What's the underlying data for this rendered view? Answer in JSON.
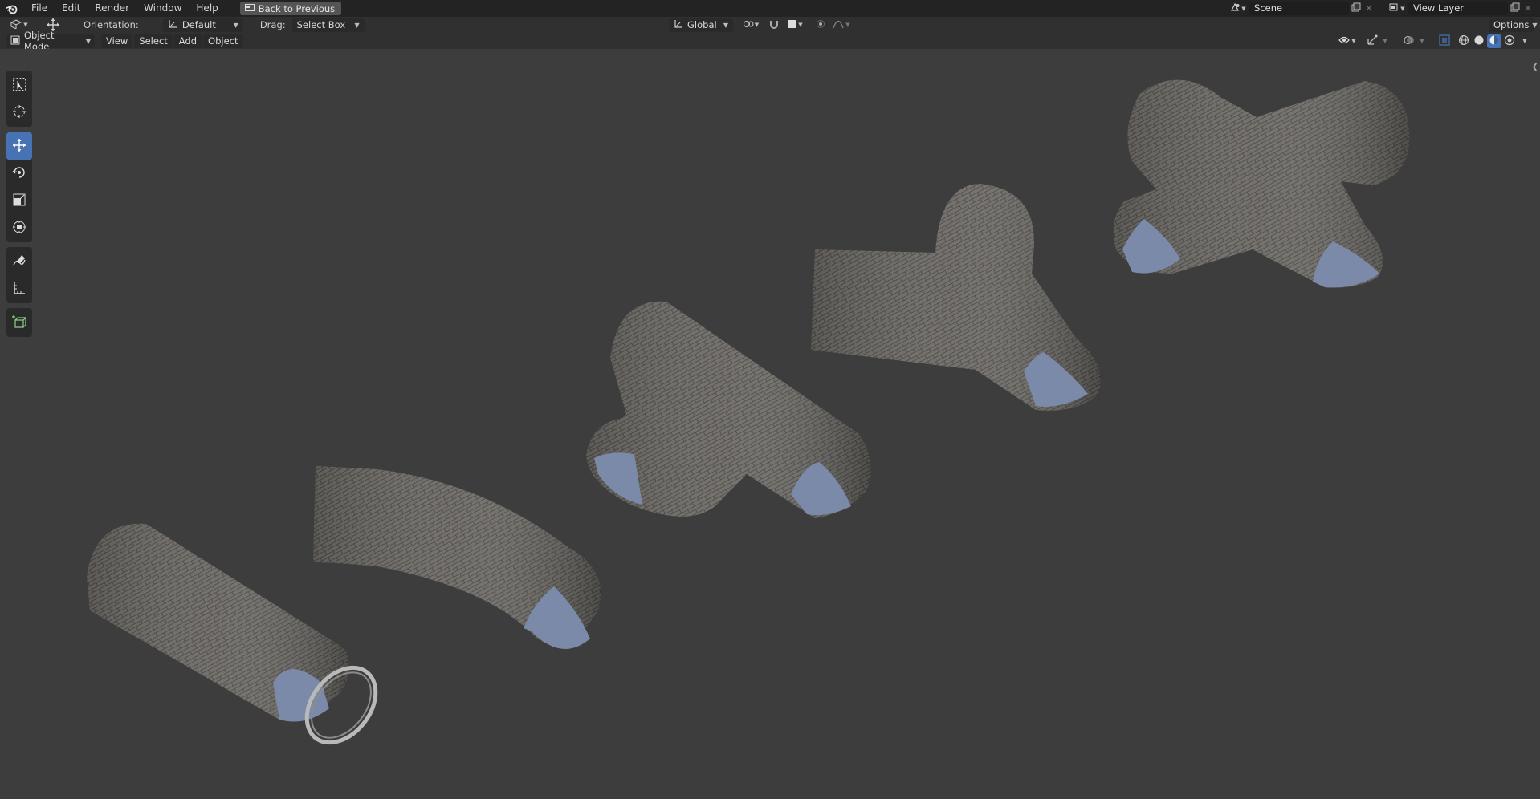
{
  "app": {
    "logo_icon": "blender-icon"
  },
  "menu": [
    "File",
    "Edit",
    "Render",
    "Window",
    "Help"
  ],
  "back_button": {
    "label": "Back to Previous",
    "icon": "screen-icon"
  },
  "scene": {
    "label": "Scene"
  },
  "view_layer": {
    "label": "View Layer"
  },
  "tool_settings": {
    "orientation_label": "Orientation:",
    "orientation_value": "Default",
    "drag_label": "Drag:",
    "drag_value": "Select Box",
    "transform_orientation": "Global",
    "options_label": "Options"
  },
  "header": {
    "mode": "Object Mode",
    "menus": [
      "View",
      "Select",
      "Add",
      "Object"
    ]
  },
  "tools": [
    "select-box-icon",
    "cursor-icon",
    "move-icon",
    "rotate-icon",
    "scale-icon",
    "transform-icon",
    "annotate-icon",
    "measure-icon",
    "add-cube-icon"
  ],
  "colors": {
    "accent": "#4772b3",
    "viewport_bg": "#3d3d3d",
    "header_bg": "#303030",
    "topbar_bg": "#232323"
  }
}
